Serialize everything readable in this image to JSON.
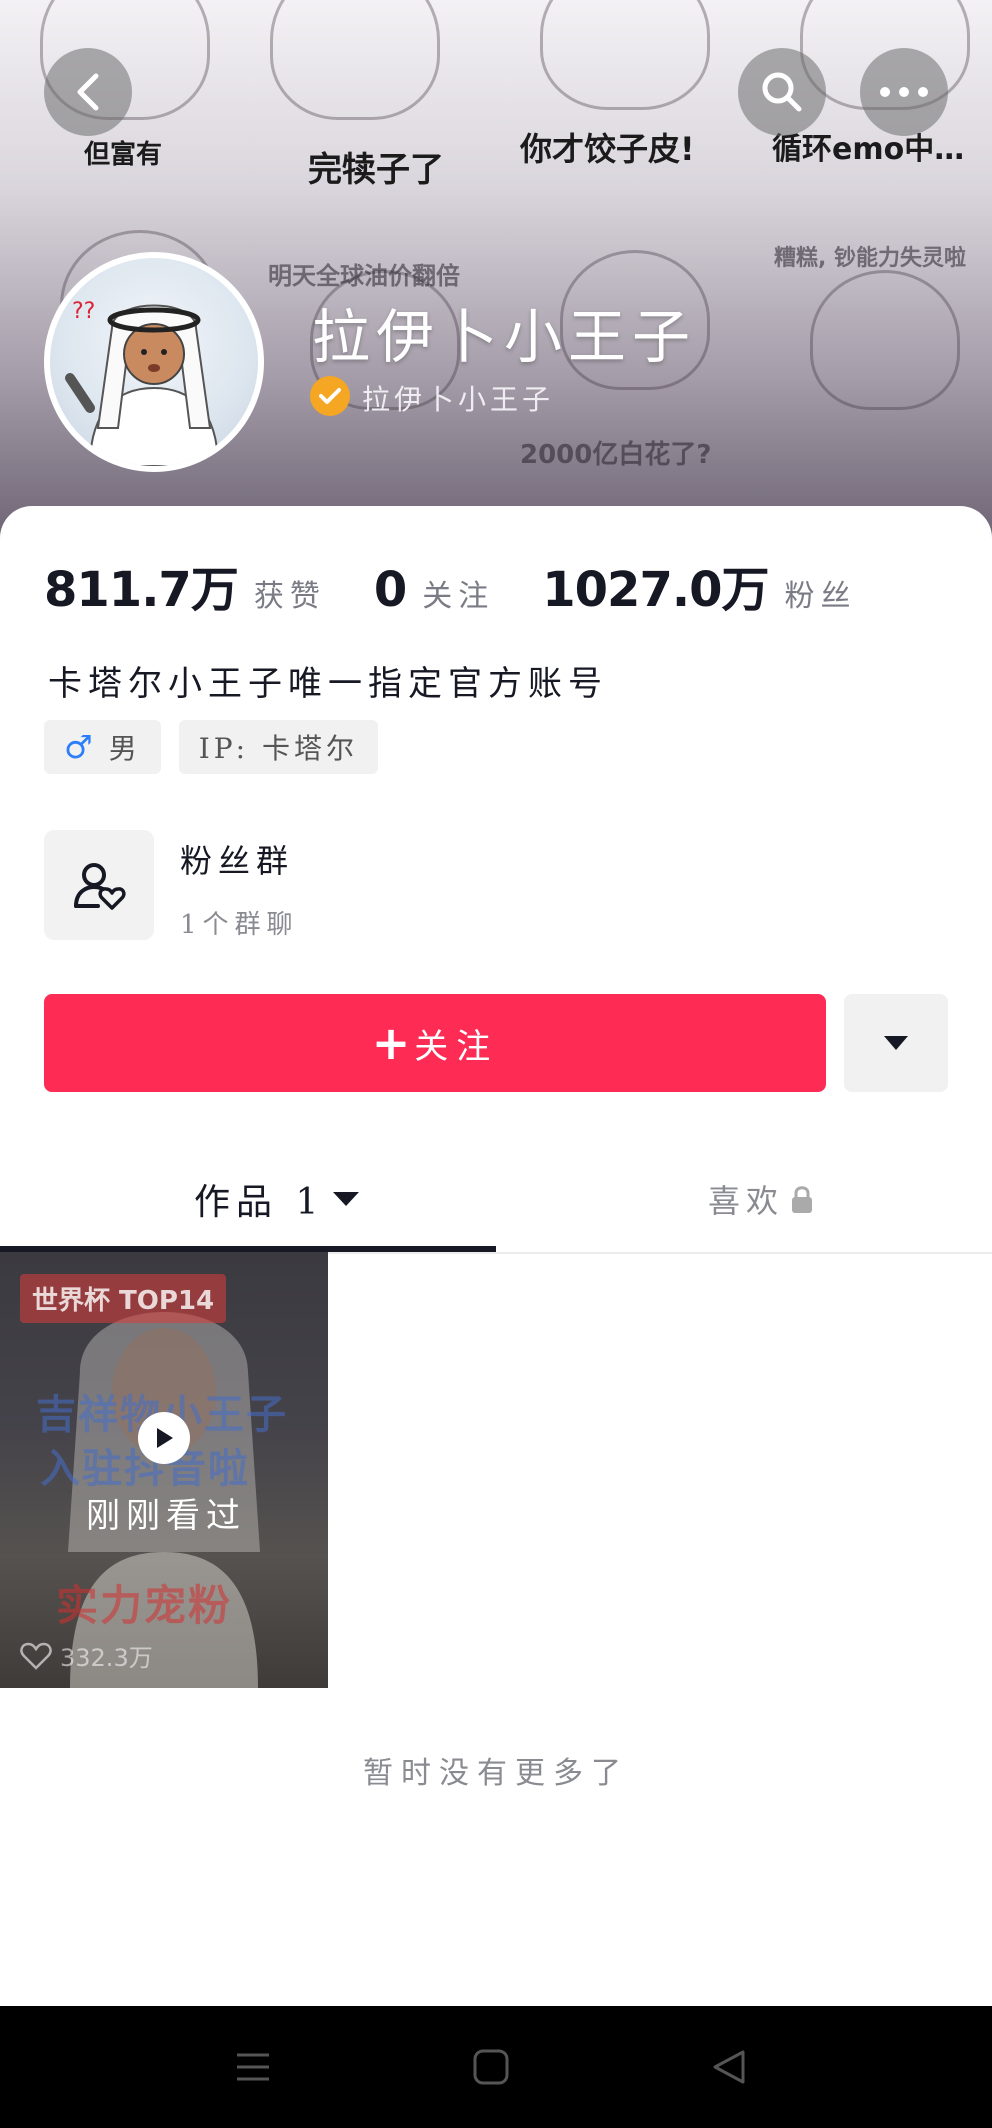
{
  "banner": {
    "captions": [
      "但富有",
      "完犊子了",
      "你才饺子皮!",
      "循环emo中…",
      "明天全球油价翻倍",
      "糟糕, 钞能力失灵啦",
      "2000亿白花了?"
    ]
  },
  "header": {
    "back_icon": "chevron-left-icon",
    "search_icon": "search-icon",
    "more_icon": "ellipsis-icon"
  },
  "profile": {
    "name": "拉伊卜小王子",
    "handle": "拉伊卜小王子",
    "verified_color": "#f5a623"
  },
  "stats": {
    "likes_value": "811.7万",
    "likes_label": "获赞",
    "following_value": "0",
    "following_label": "关注",
    "followers_value": "1027.0万",
    "followers_label": "粉丝"
  },
  "bio": "卡塔尔小王子唯一指定官方账号",
  "tags": {
    "gender_symbol": "♂",
    "gender": "男",
    "ip": "IP: 卡塔尔"
  },
  "fan_group": {
    "title": "粉丝群",
    "subtitle": "1个群聊"
  },
  "actions": {
    "follow_plus": "+",
    "follow_label": "关注",
    "accent_color": "#fe2c55"
  },
  "tabs": {
    "works_label": "作品 1",
    "likes_label": "喜欢"
  },
  "video": {
    "badge": "世界杯 TOP14",
    "title_top": "吉祥物小王子",
    "title_mid": "入驻抖音啦",
    "title_bottom": "实力宠粉",
    "overlay": "刚刚看过",
    "like_count": "332.3万"
  },
  "footer_text": "暂时没有更多了"
}
